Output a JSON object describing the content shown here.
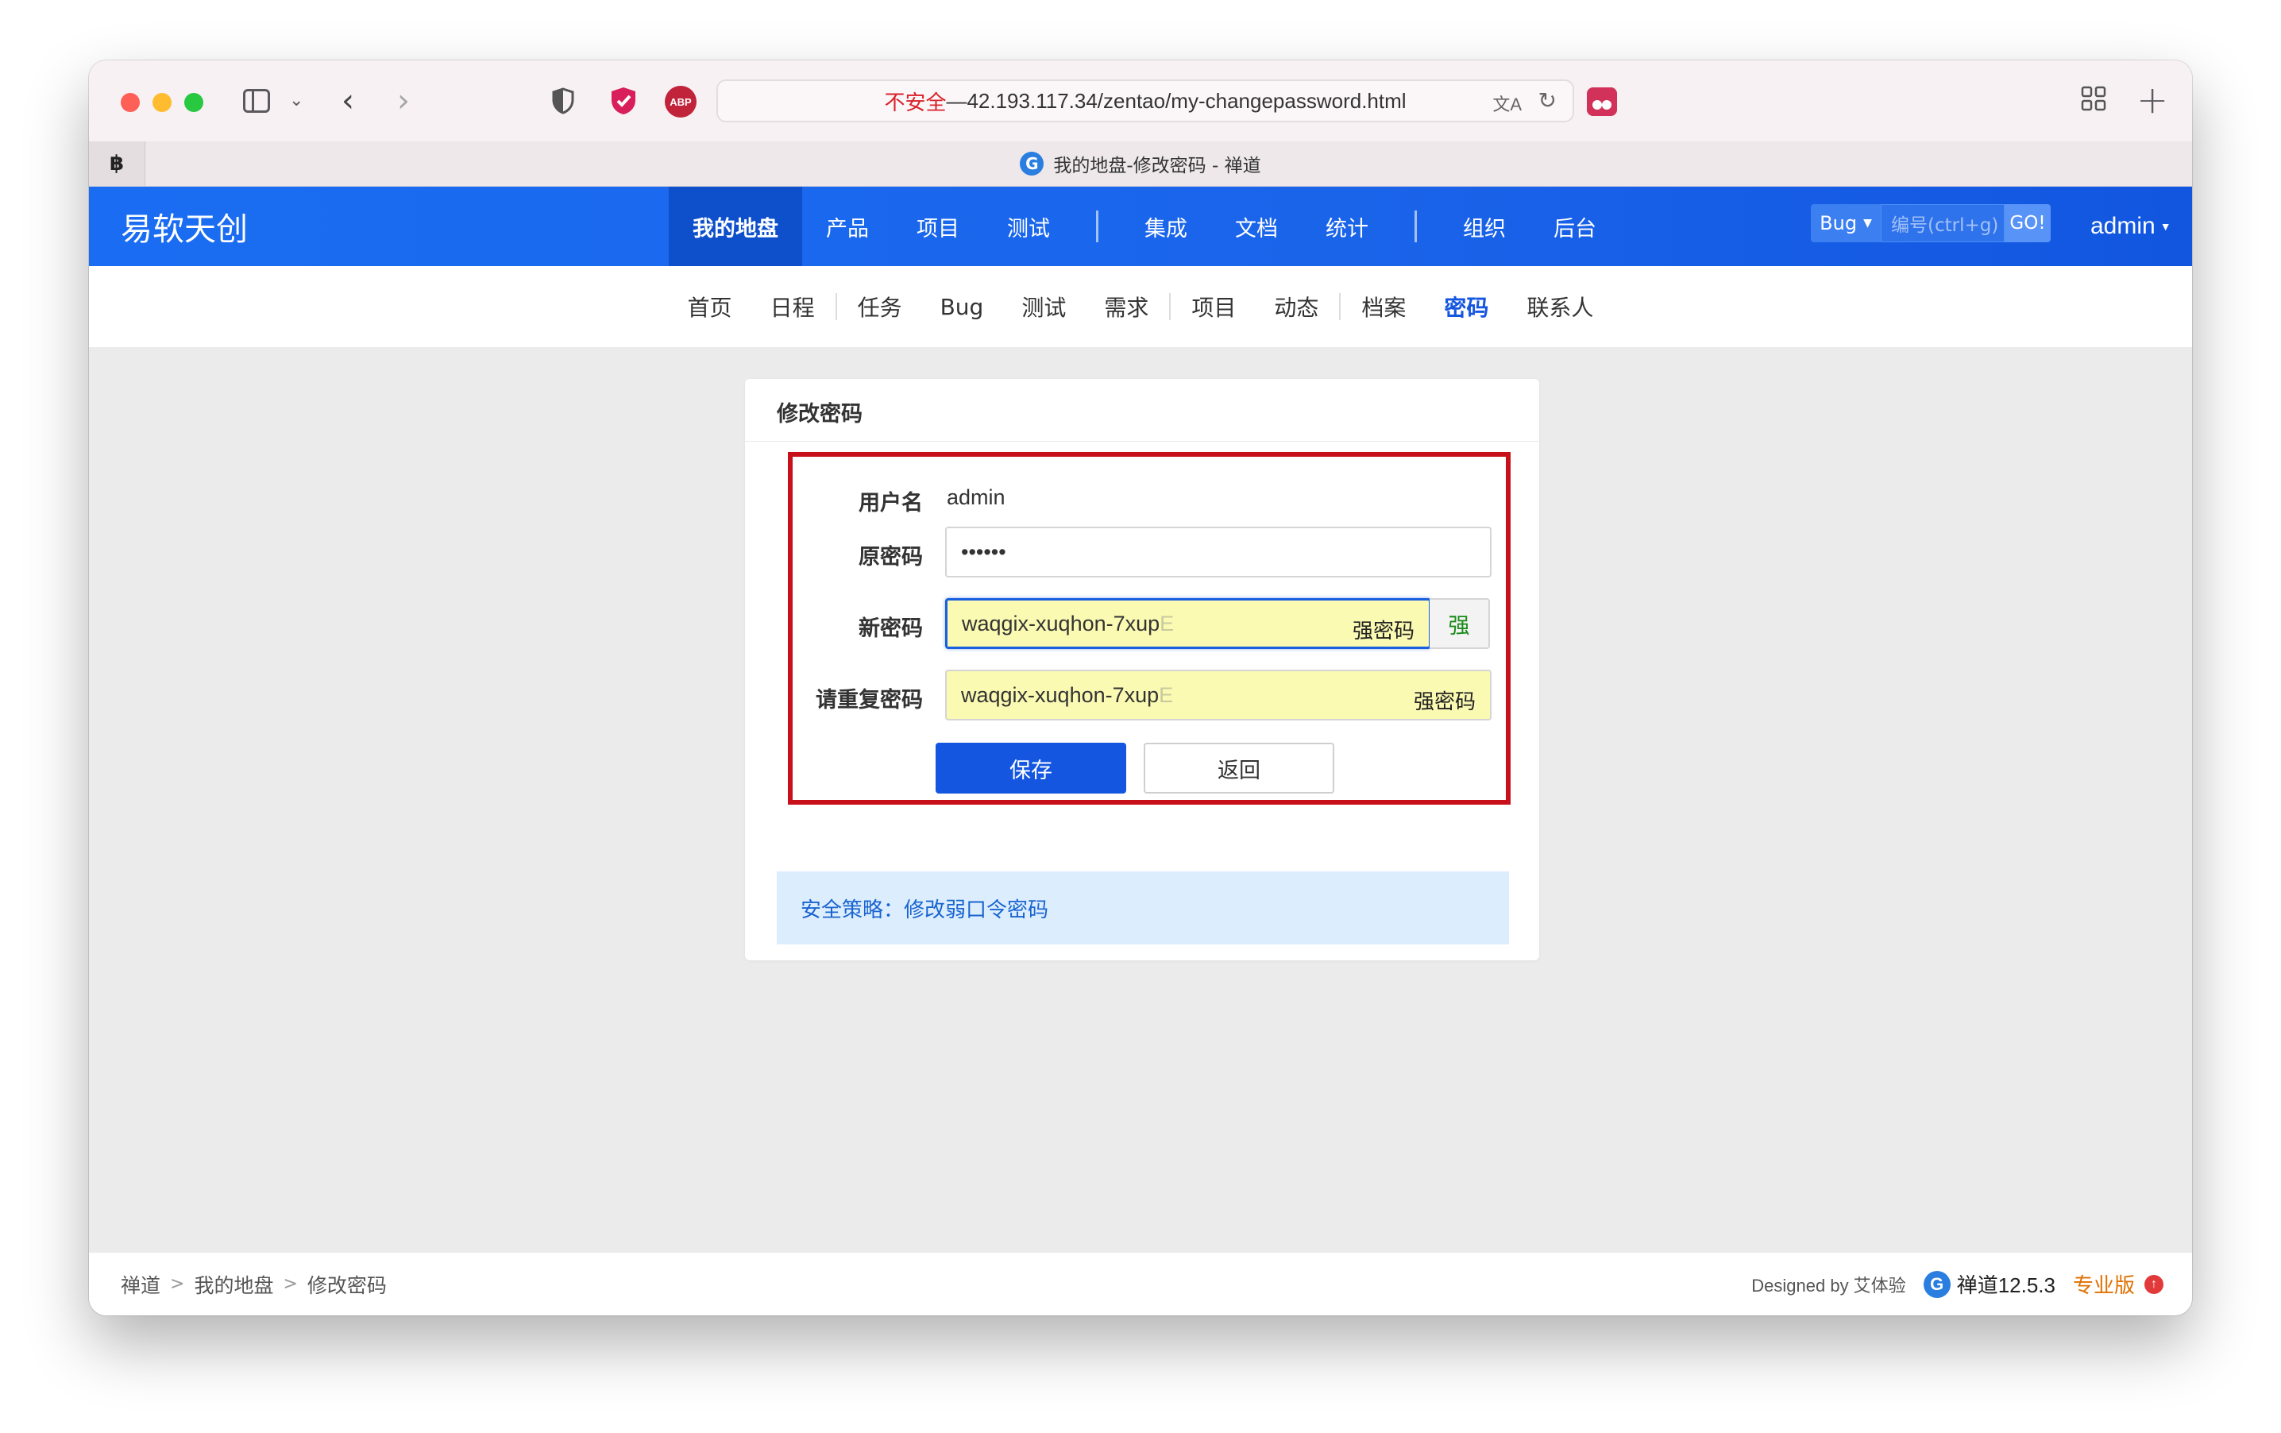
{
  "browser": {
    "address": {
      "insecure_label": "不安全",
      "separator": " — ",
      "url": "42.193.117.34/zentao/my-changepassword.html"
    },
    "pinned_tab_label": "฿",
    "tab_title": "我的地盘-修改密码 - 禅道",
    "icons": {
      "sidebar": "sidebar-icon",
      "back": "back-icon",
      "forward": "forward-icon",
      "privacy": "shield-icon",
      "ext_check": "check-shield-icon",
      "adblock": "adblock-icon",
      "translate": "translate-icon",
      "reload": "reload-icon",
      "tab_overview": "tab-overview-icon",
      "new_tab": "plus-icon"
    },
    "abp_text": "ABP"
  },
  "header": {
    "brand": "易软天创",
    "nav": [
      {
        "label": "我的地盘",
        "active": true
      },
      {
        "label": "产品"
      },
      {
        "label": "项目"
      },
      {
        "label": "测试"
      },
      {
        "label": "集成"
      },
      {
        "label": "文档"
      },
      {
        "label": "统计"
      },
      {
        "label": "组织"
      },
      {
        "label": "后台"
      }
    ],
    "search": {
      "type": "Bug",
      "placeholder": "编号(ctrl+g)",
      "go": "GO!"
    },
    "user": "admin"
  },
  "subnav": [
    {
      "label": "首页"
    },
    {
      "label": "日程"
    },
    {
      "label": "任务"
    },
    {
      "label": "Bug"
    },
    {
      "label": "测试"
    },
    {
      "label": "需求"
    },
    {
      "label": "项目"
    },
    {
      "label": "动态"
    },
    {
      "label": "档案"
    },
    {
      "label": "密码",
      "active": true
    },
    {
      "label": "联系人"
    }
  ],
  "form": {
    "title": "修改密码",
    "username_label": "用户名",
    "username_value": "admin",
    "old_password_label": "原密码",
    "old_password_value": "••••••",
    "new_password_label": "新密码",
    "new_password_value": "waqgix-xuqhon-7xup",
    "new_password_fade": "E",
    "new_password_badge": "强密码",
    "strength_label": "强",
    "repeat_password_label": "请重复密码",
    "repeat_password_value": "waqgix-xuqhon-7xup",
    "repeat_password_fade": "E",
    "repeat_password_badge": "强密码",
    "save_label": "保存",
    "back_label": "返回",
    "notice": "安全策略：修改弱口令密码",
    "highlight_color": "#c8101a"
  },
  "footer": {
    "breadcrumb": [
      "禅道",
      "我的地盘",
      "修改密码"
    ],
    "designed_by": "Designed by 艾体验",
    "version": "禅道12.5.3",
    "edition": "专业版",
    "upgrade_icon": "arrow-up-circle-icon"
  },
  "colors": {
    "primary": "#1456e0",
    "header_bg": "#1a6df2",
    "active_tab": "#0e4fcb",
    "strength_green": "#1a8a1a"
  }
}
